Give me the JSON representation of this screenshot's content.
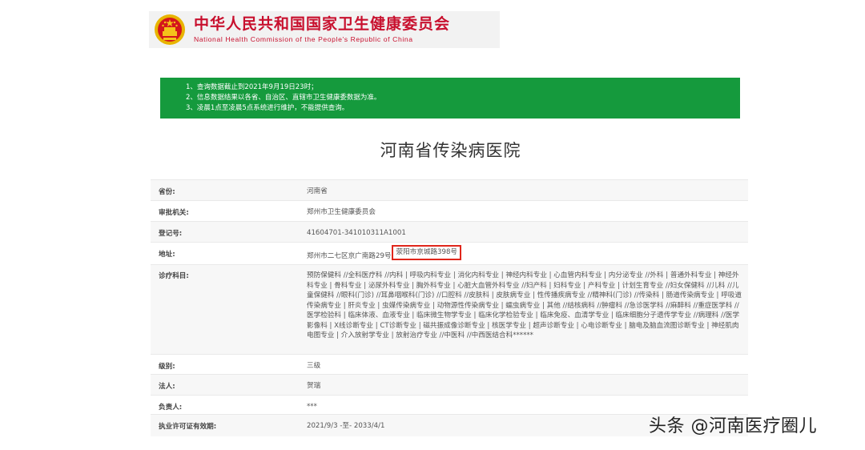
{
  "header": {
    "title": "中华人民共和国国家卫生健康委员会",
    "subtitle": "National Health Commission of the People's Republic of China"
  },
  "notice": {
    "lines": [
      "1、查询数据截止到2021年9月19日23时；",
      "2、信息数据结果以各省、自治区、直辖市卫生健康委数据为准。",
      "3、凌晨1点至凌晨5点系统进行维护，不能提供查询。"
    ]
  },
  "page_title": "河南省传染病医院",
  "info": {
    "province_label": "省份:",
    "province_value": "河南省",
    "authority_label": "审批机关:",
    "authority_value": "郑州市卫生健康委员会",
    "reg_label": "登记号:",
    "reg_value": "41604701-341010311A1001",
    "address_label": "地址:",
    "address_value_1": "郑州市二七区京广南路29号",
    "address_value_2": "荥阳市京城路398号",
    "scope_label": "诊疗科目:",
    "scope_value": "预防保健科 //全科医疗科 //内科 | 呼吸内科专业 | 消化内科专业 | 神经内科专业 | 心血管内科专业 | 内分泌专业 //外科 | 普通外科专业 | 神经外科专业 | 骨科专业 | 泌尿外科专业 | 胸外科专业 | 心脏大血管外科专业 //妇产科 | 妇科专业 | 产科专业 | 计划生育专业 //妇女保健科 //儿科 //儿童保健科 //眼科(门诊) //耳鼻咽喉科(门诊) //口腔科 //皮肤科 | 皮肤病专业 | 性传播疾病专业 //精神科(门诊) //传染科 | 肠道传染病专业 | 呼吸道传染病专业 | 肝炎专业 | 虫媒传染病专业 | 动物源性传染病专业 | 蠕虫病专业 | 其他 //结核病科 //肿瘤科 //急诊医学科 //麻醉科 //重症医学科 //医学检验科 | 临床体液、血液专业 | 临床微生物学专业 | 临床化学检验专业 | 临床免疫、血清学专业 | 临床细胞分子遗传学专业 //病理科 //医学影像科 | X线诊断专业 | CT诊断专业 | 磁共振成像诊断专业 | 核医学专业 | 超声诊断专业 | 心电诊断专业 | 脑电及脑血流图诊断专业 | 神经肌肉电图专业 | 介入放射学专业 | 放射治疗专业 //中医科 //中西医结合科******",
    "level_label": "级别:",
    "level_value": "三级",
    "legal_label": "法人:",
    "legal_value": "贺瑞",
    "head_label": "负责人:",
    "head_value": "***",
    "license_label": "执业许可证有效期:",
    "license_value": "2021/9/3 -至- 2033/4/1"
  },
  "watermark": "头条 @河南医疗圈儿",
  "colors": {
    "brand_red": "#c8102e",
    "notice_green": "#159a3d",
    "highlight_red": "#e0261b"
  }
}
